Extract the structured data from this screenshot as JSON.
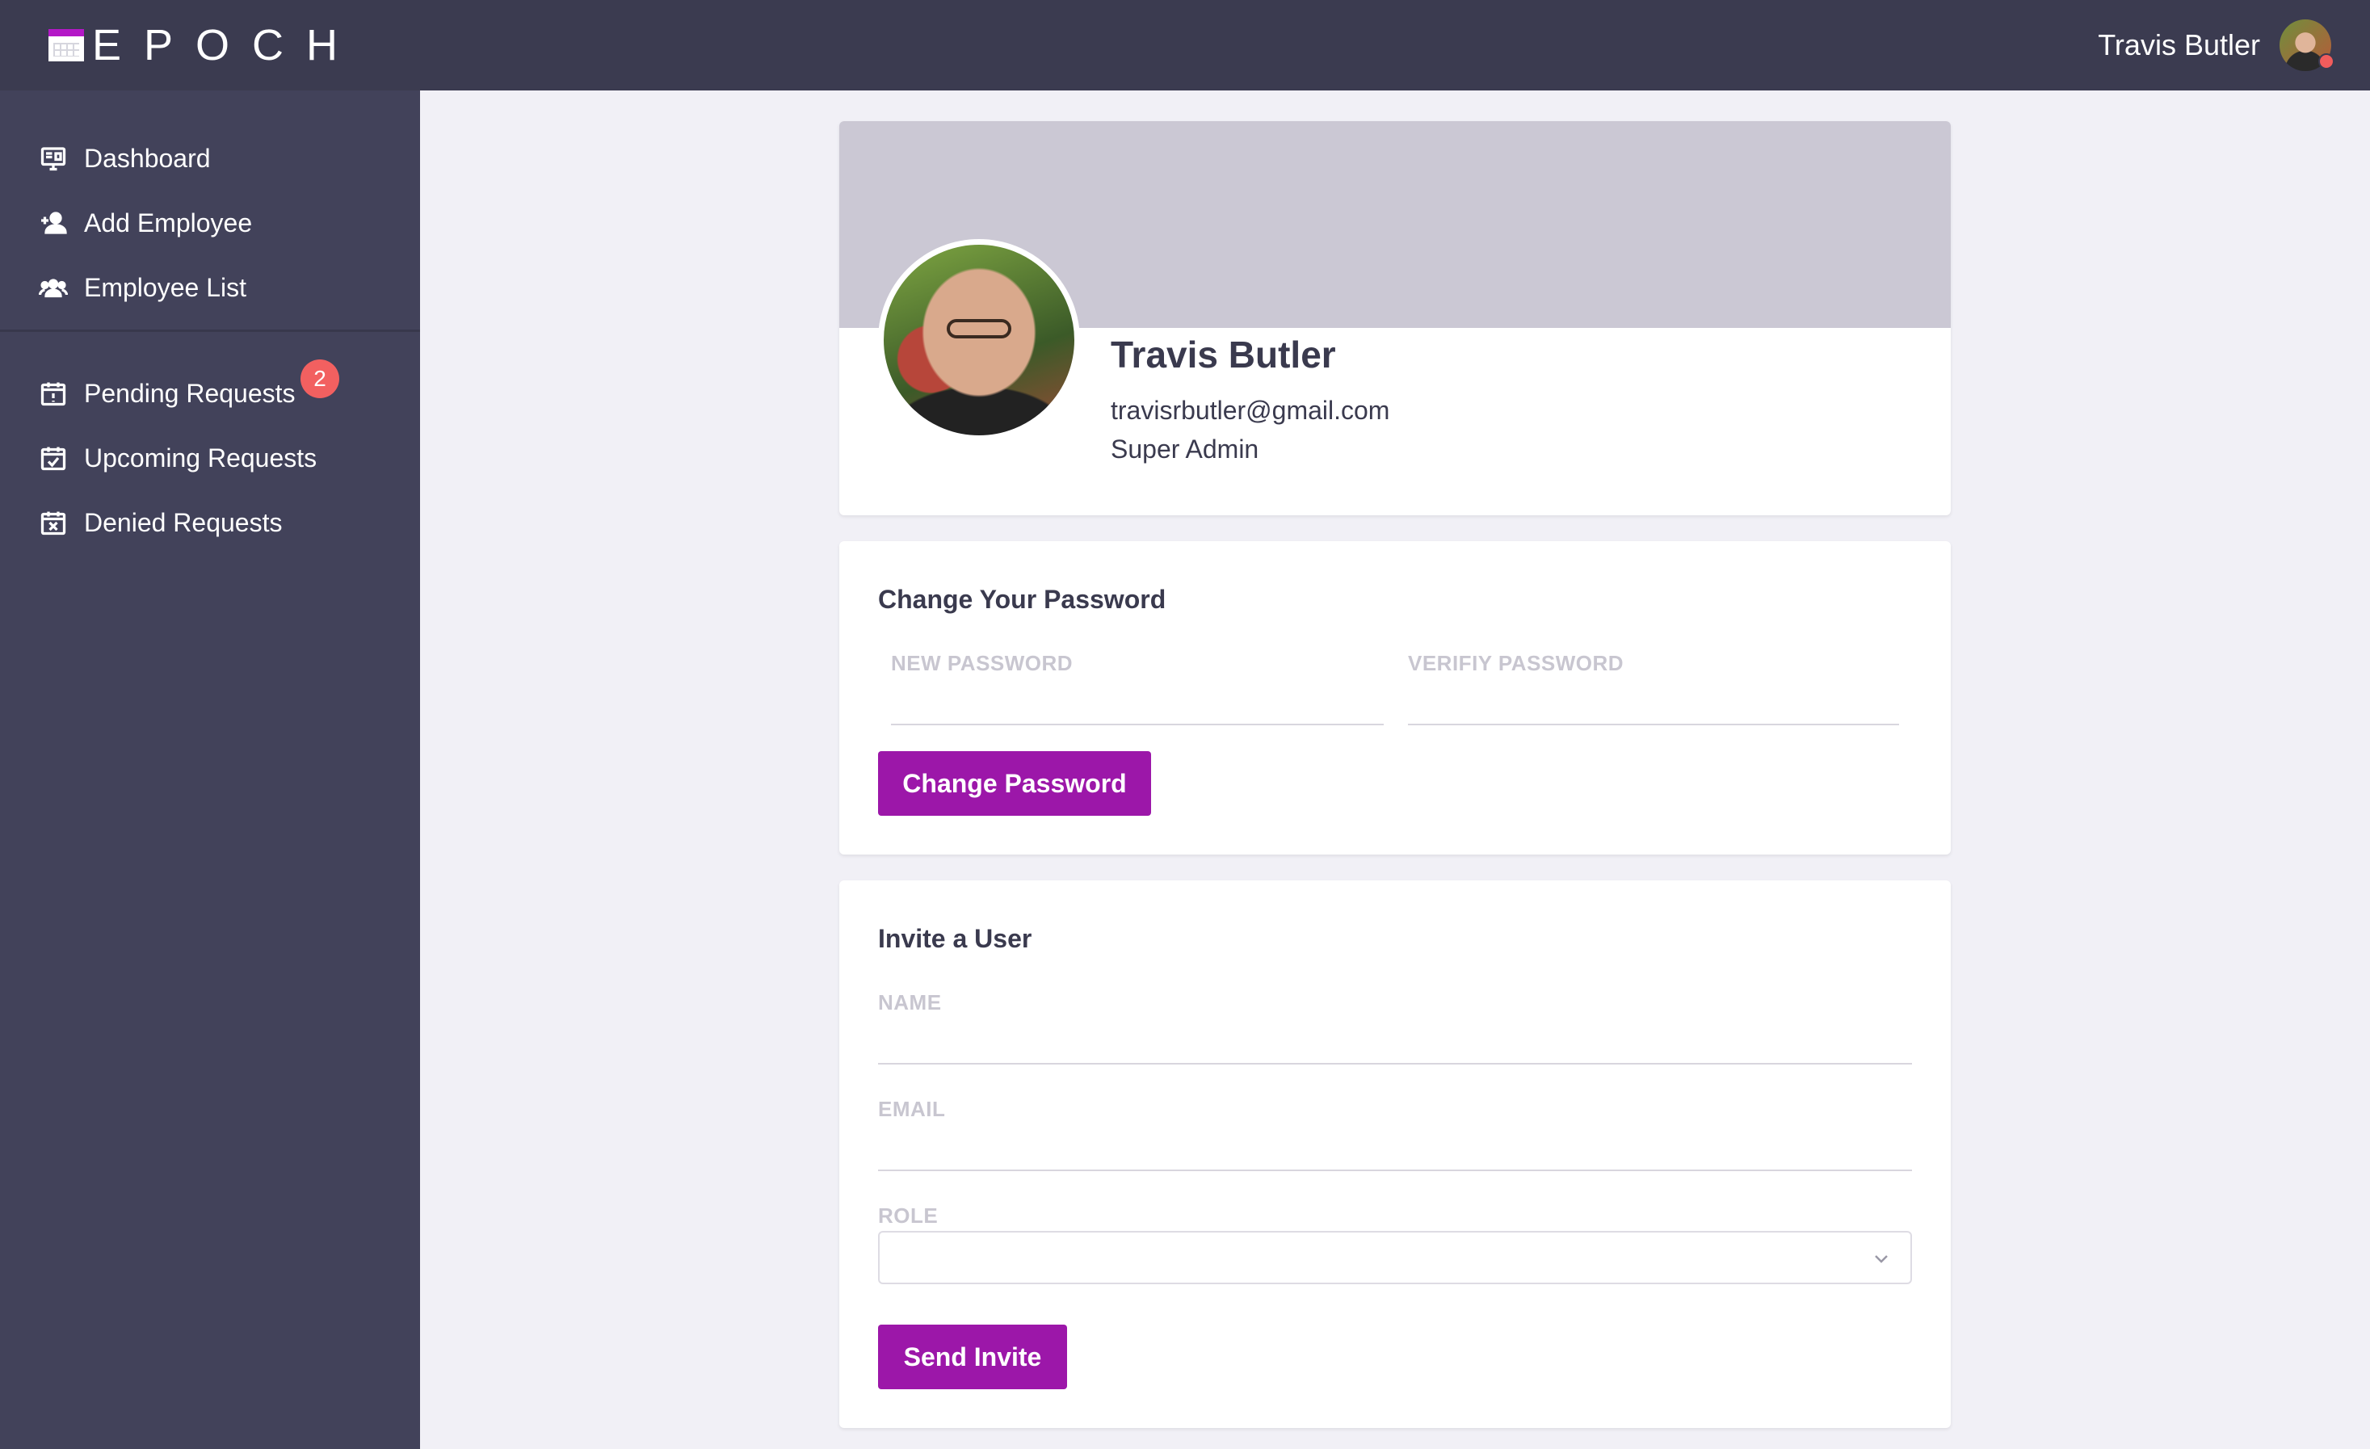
{
  "brand": {
    "name": "EPOCH"
  },
  "user": {
    "name": "Travis Butler"
  },
  "sidebar": {
    "items": [
      {
        "label": "Dashboard",
        "icon": "dashboard-icon"
      },
      {
        "label": "Add Employee",
        "icon": "add-user-icon"
      },
      {
        "label": "Employee List",
        "icon": "users-icon"
      }
    ],
    "requests": [
      {
        "label": "Pending Requests",
        "icon": "calendar-alert-icon",
        "badge": "2"
      },
      {
        "label": "Upcoming Requests",
        "icon": "calendar-check-icon"
      },
      {
        "label": "Denied Requests",
        "icon": "calendar-x-icon"
      }
    ]
  },
  "profile": {
    "name": "Travis Butler",
    "email": "travisrbutler@gmail.com",
    "role": "Super Admin"
  },
  "password_form": {
    "title": "Change Your Password",
    "new_password_label": "NEW PASSWORD",
    "verify_password_label": "VERIFIY PASSWORD",
    "submit_label": "Change Password"
  },
  "invite_form": {
    "title": "Invite a User",
    "name_label": "NAME",
    "email_label": "EMAIL",
    "role_label": "ROLE",
    "submit_label": "Send Invite"
  },
  "colors": {
    "topbar": "#3b3b50",
    "sidebar": "#42425a",
    "accent": "#9c17a9",
    "badge": "#f26060"
  }
}
